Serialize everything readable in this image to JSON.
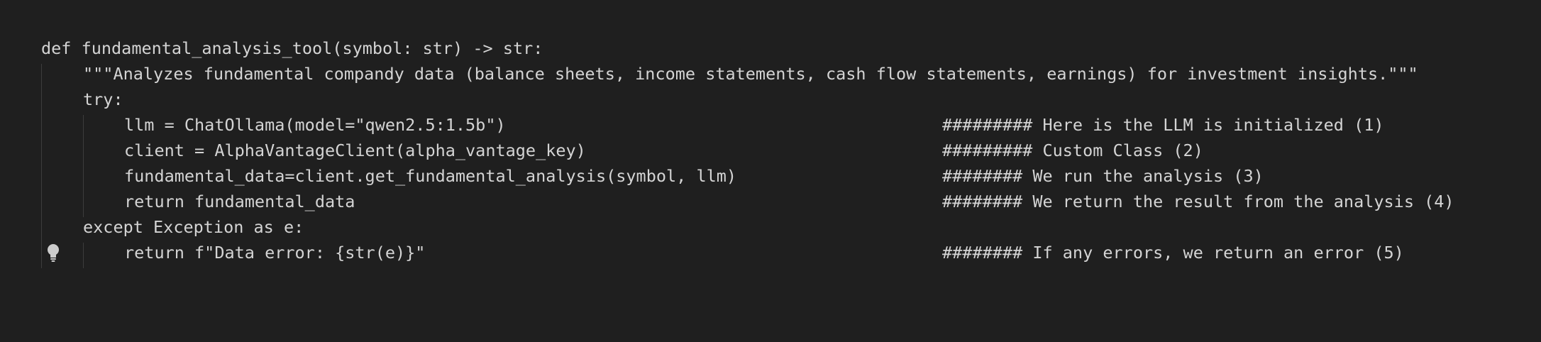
{
  "code_lines": [
    {
      "text": "def fundamental_analysis_tool(symbol: str) -> str:",
      "comment": ""
    },
    {
      "text": "\"\"\"Analyzes fundamental compandy data (balance sheets, income statements, cash flow statements, earnings) for investment insights.\"\"\"",
      "comment": ""
    },
    {
      "text": "try:",
      "comment": ""
    },
    {
      "text": "llm = ChatOllama(model=\"qwen2.5:1.5b\")",
      "comment": "######### Here is the LLM is initialized (1)"
    },
    {
      "text": "client = AlphaVantageClient(alpha_vantage_key)",
      "comment": "######### Custom Class (2)"
    },
    {
      "text": "fundamental_data=client.get_fundamental_analysis(symbol, llm)",
      "comment": "######## We run the analysis (3)"
    },
    {
      "text": "return fundamental_data",
      "comment": "######## We return the result from the analysis (4)"
    },
    {
      "text": "except Exception as e:",
      "comment": ""
    },
    {
      "text": "return f\"Data error: {str(e)}\"",
      "comment": "######## If any errors, we return an error (5)"
    }
  ],
  "icons": {
    "lightbulb": "lightbulb-icon"
  },
  "colors": {
    "background": "#1f1f1f",
    "text": "#d4d4d4",
    "indent_guide": "#3c3c3c"
  }
}
